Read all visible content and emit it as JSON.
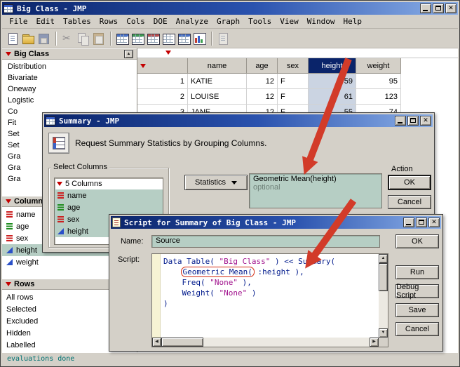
{
  "colors": {
    "titlebar_start": "#0a246a",
    "titlebar_end": "#8cb0e8",
    "chrome": "#d4d0c8",
    "teal_field": "#b6cec4",
    "selected_header_bg": "#0a246a",
    "selected_cell_bg": "#cbd4e2",
    "arrow_red": "#d23b29",
    "status_text": "#007272",
    "code_default": "#001a8c",
    "code_string": "#a2148e",
    "red_triangle": "#c40000"
  },
  "main_window": {
    "title": "Big Class - JMP",
    "menu_items": [
      "File",
      "Edit",
      "Tables",
      "Rows",
      "Cols",
      "DOE",
      "Analyze",
      "Graph",
      "Tools",
      "View",
      "Window",
      "Help"
    ],
    "toolbar_icons": [
      {
        "name": "new-doc-icon",
        "cls": "i-doc"
      },
      {
        "name": "open-folder-icon",
        "cls": "i-folder"
      },
      {
        "name": "save-icon",
        "cls": "i-disk dim"
      },
      {
        "name": "separator"
      },
      {
        "name": "cut-icon",
        "cls": "i-cut dim"
      },
      {
        "name": "copy-icon",
        "cls": "i-copy dim"
      },
      {
        "name": "paste-icon",
        "cls": "i-paste dim"
      },
      {
        "name": "separator"
      },
      {
        "name": "data-table-icon",
        "cls": "i-table t-blue"
      },
      {
        "name": "summary-table-icon",
        "cls": "i-table t-green"
      },
      {
        "name": "sort-table-icon",
        "cls": "i-table t-red"
      },
      {
        "name": "join-table-icon",
        "cls": "i-table"
      },
      {
        "name": "grid-table-icon",
        "cls": "i-table t-blue"
      },
      {
        "name": "chart-icon",
        "cls": "i-chart"
      },
      {
        "name": "separator"
      },
      {
        "name": "annotate-icon",
        "cls": "i-doc dim"
      }
    ],
    "sidebar": {
      "panel_title": "Big Class",
      "analyses": [
        "Distribution",
        "Bivariate",
        "Oneway",
        "Logistic",
        "Co",
        "Fit",
        "Set",
        "Set",
        "Gra",
        "Gra",
        "Gra"
      ],
      "columns_panel_title": "Columns",
      "columns": [
        {
          "label": "name",
          "type": "nominal"
        },
        {
          "label": "age",
          "type": "ordinal"
        },
        {
          "label": "sex",
          "type": "nominal"
        },
        {
          "label": "height",
          "type": "continuous",
          "selected": true
        },
        {
          "label": "weight",
          "type": "continuous"
        }
      ],
      "rows_panel_title": "Rows",
      "row_items": [
        "All rows",
        "Selected",
        "Excluded",
        "Hidden",
        "Labelled"
      ],
      "status_text": "evaluations done"
    },
    "data_table": {
      "column_headers": [
        "name",
        "age",
        "sex",
        "height",
        "weight"
      ],
      "selected_column": "height",
      "rows": [
        [
          "1",
          "KATIE",
          "12",
          "F",
          "59",
          "95"
        ],
        [
          "2",
          "LOUISE",
          "12",
          "F",
          "61",
          "123"
        ],
        [
          "3",
          "JANE",
          "12",
          "F",
          "55",
          "74"
        ]
      ]
    }
  },
  "summary_dialog": {
    "title": "Summary - JMP",
    "prompt": "Request Summary Statistics by Grouping Columns.",
    "select_columns_label": "Select Columns",
    "columns_count_label": "5 Columns",
    "columns": [
      {
        "label": "name",
        "type": "nominal",
        "selected": true
      },
      {
        "label": "age",
        "type": "ordinal",
        "selected": true
      },
      {
        "label": "sex",
        "type": "nominal",
        "selected": true
      },
      {
        "label": "height",
        "type": "continuous",
        "selected": true
      }
    ],
    "statistics_button_label": "Statistics",
    "statistics_value": "Geometric Mean(height)",
    "statistics_placeholder": "optional",
    "action_label": "Action",
    "ok_label": "OK",
    "cancel_label": "Cancel"
  },
  "script_window": {
    "title": "Script for Summary of Big Class - JMP",
    "name_label": "Name:",
    "name_value": "Source",
    "script_label": "Script:",
    "buttons": [
      "OK",
      "Run",
      "Debug Script",
      "Save",
      "Cancel"
    ],
    "code_lines": [
      [
        {
          "t": "Data Table( "
        },
        {
          "t": "\"Big Class\"",
          "s": "str"
        },
        {
          "t": " ) << Summary("
        }
      ],
      [
        {
          "t": "    "
        },
        {
          "t": "Geometric Mean(",
          "boxed": true
        },
        {
          "t": " :height ),"
        }
      ],
      [
        {
          "t": "    Freq( "
        },
        {
          "t": "\"None\"",
          "s": "str"
        },
        {
          "t": " ),"
        }
      ],
      [
        {
          "t": "    Weight( "
        },
        {
          "t": "\"None\"",
          "s": "str"
        },
        {
          "t": " )"
        }
      ],
      [
        {
          "t": ")"
        }
      ]
    ]
  }
}
